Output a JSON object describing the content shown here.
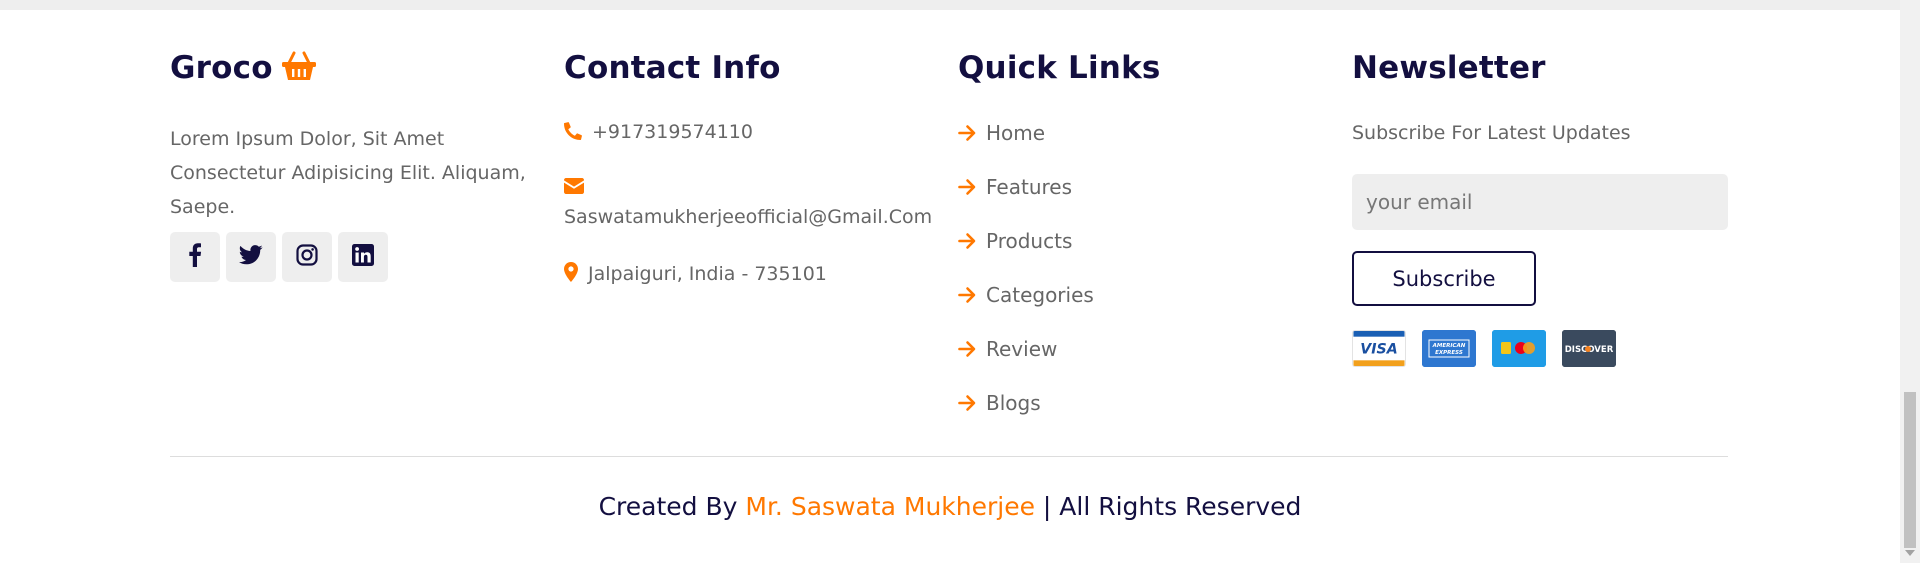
{
  "brand": {
    "title": "Groco",
    "icon": "shopping-basket-icon",
    "description": "Lorem Ipsum Dolor, Sit Amet Consectetur Adipisicing Elit. Aliquam, Saepe.",
    "socials": [
      "facebook-icon",
      "twitter-icon",
      "instagram-icon",
      "linkedin-icon"
    ]
  },
  "contact": {
    "title": "Contact Info",
    "phone": "+917319574110",
    "email": "Saswatamukherjeeofficial@Gmail.Com",
    "address": "Jalpaiguri, India - 735101"
  },
  "quick_links": {
    "title": "Quick Links",
    "items": [
      "Home",
      "Features",
      "Products",
      "Categories",
      "Review",
      "Blogs"
    ]
  },
  "newsletter": {
    "title": "Newsletter",
    "subtitle": "Subscribe For Latest Updates",
    "email_placeholder": "your email",
    "button_label": "Subscribe",
    "cards": [
      "VISA",
      "AMERICAN EXPRESS",
      "mastercard",
      "DISCOVER"
    ]
  },
  "credit": {
    "prefix": "Created By ",
    "author": "Mr. Saswata Mukherjee",
    "suffix": " | All Rights Reserved"
  },
  "colors": {
    "accent": "#ff7800",
    "heading": "#130f40",
    "text": "#666666",
    "light_bg": "#eeeeee"
  }
}
